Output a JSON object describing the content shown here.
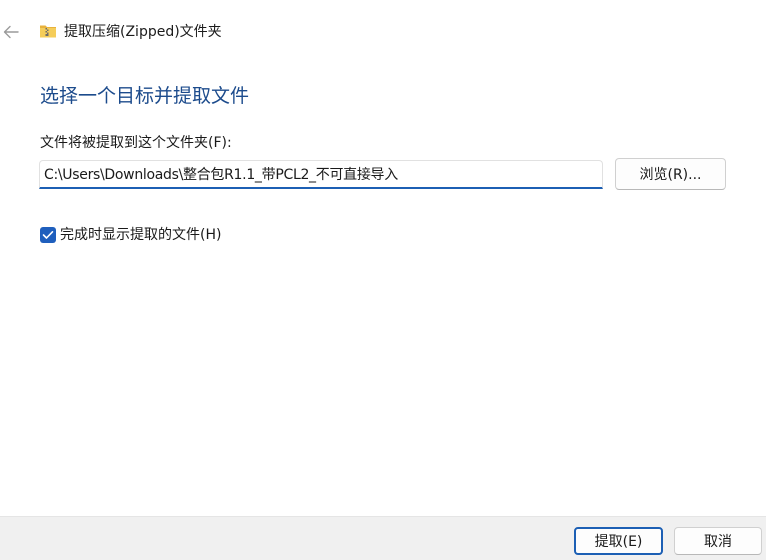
{
  "window": {
    "title": "提取压缩(Zipped)文件夹",
    "back_icon": "arrow-left-icon",
    "folder_icon": "zip-folder-icon"
  },
  "main": {
    "heading": "选择一个目标并提取文件",
    "folder_label": "文件将被提取到这个文件夹(F):",
    "path_value": "C:\\Users\\Downloads\\整合包R1.1_带PCL2_不可直接导入",
    "browse_label": "浏览(R)...",
    "show_files_label": "完成时显示提取的文件(H)",
    "show_files_checked": true
  },
  "footer": {
    "extract_label": "提取(E)",
    "cancel_label": "取消"
  },
  "colors": {
    "accent": "#1c5fb4",
    "heading": "#1c4b8c",
    "footer_bg": "#f0f0f0"
  }
}
